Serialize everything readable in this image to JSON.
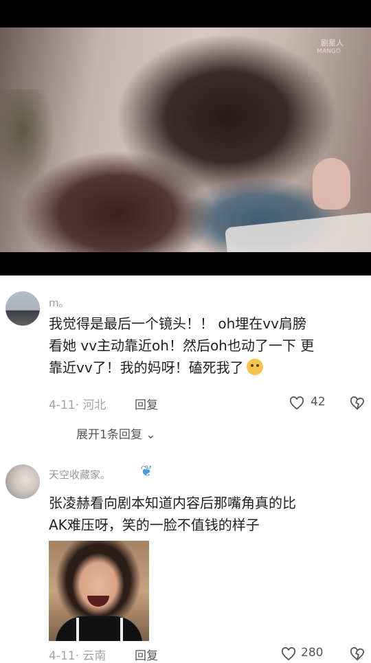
{
  "video": {
    "watermark_1": "剧星人",
    "watermark_2": "MANGO"
  },
  "comments": [
    {
      "username": "m。",
      "text_lines": [
        "我觉得是最后一个镜头！！ oh埋在vv肩膀",
        "看她 vv主动靠近oh！然后oh也动了一下 更",
        "靠近vv了！我的妈呀！磕死我了"
      ],
      "emoji": "grinning-cat-emoji",
      "date_location": "4-11· 河北",
      "reply_label": "回复",
      "likes": "42",
      "expand_label": "展开1条回复"
    },
    {
      "username": "天空收藏家。",
      "username_icon": "butterfly-icon",
      "text_lines": [
        "张凌赫看向剧本知道内容后那嘴角真的比",
        "AK难压呀，笑的一脸不值钱的样子"
      ],
      "sticker": "laughing-girl-sticker",
      "date_location": "4-11· 云南",
      "reply_label": "回复",
      "likes": "280"
    }
  ],
  "colors": {
    "text": "#1f1f1f",
    "meta": "#a3a3a3",
    "butterfly": "#4a9bd6"
  }
}
